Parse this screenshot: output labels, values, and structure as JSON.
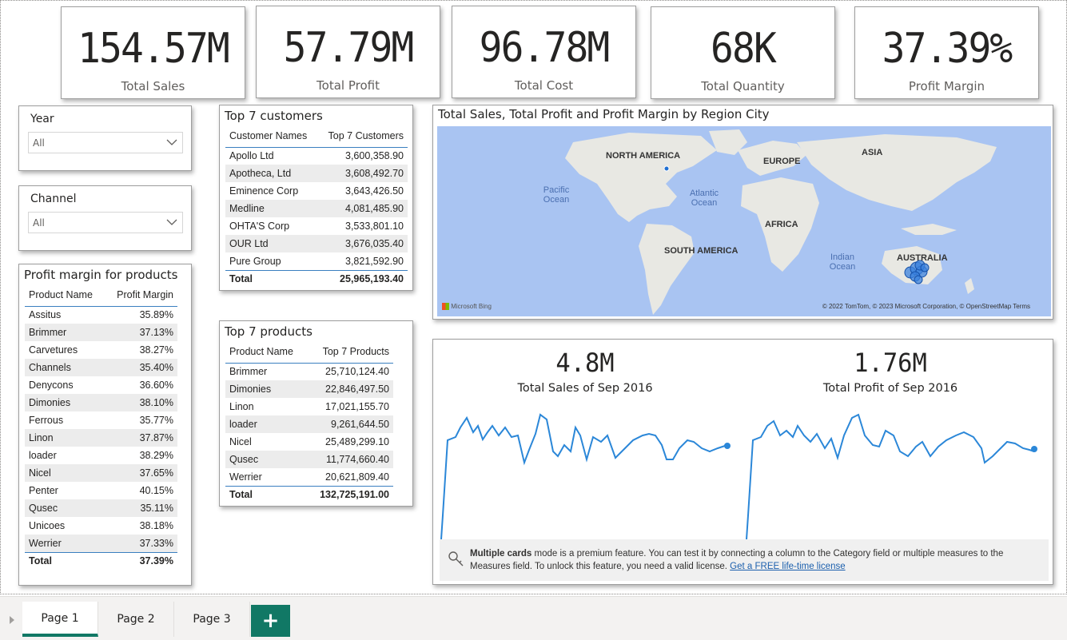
{
  "kpis": [
    {
      "value": "154.57M",
      "label": "Total Sales"
    },
    {
      "value": "57.79M",
      "label": "Total Profit"
    },
    {
      "value": "96.78M",
      "label": "Total Cost"
    },
    {
      "value": "68K",
      "label": "Total Quantity"
    },
    {
      "value": "37.39%",
      "label": "Profit Margin"
    }
  ],
  "slicers": {
    "year": {
      "title": "Year",
      "value": "All"
    },
    "channel": {
      "title": "Channel",
      "value": "All"
    }
  },
  "profit_margin_table": {
    "title": "Profit margin for products",
    "columns": [
      "Product Name",
      "Profit Margin"
    ],
    "rows": [
      [
        "Assitus",
        "35.89%"
      ],
      [
        "Brimmer",
        "37.13%"
      ],
      [
        "Carvetures",
        "38.27%"
      ],
      [
        "Channels",
        "35.40%"
      ],
      [
        "Denycons",
        "36.60%"
      ],
      [
        "Dimonies",
        "38.10%"
      ],
      [
        "Ferrous",
        "35.77%"
      ],
      [
        "Linon",
        "37.87%"
      ],
      [
        "loader",
        "38.29%"
      ],
      [
        "Nicel",
        "37.65%"
      ],
      [
        "Penter",
        "40.15%"
      ],
      [
        "Qusec",
        "35.11%"
      ],
      [
        "Unicoes",
        "38.18%"
      ],
      [
        "Werrier",
        "37.33%"
      ]
    ],
    "total": [
      "Total",
      "37.39%"
    ]
  },
  "top_customers_table": {
    "title": "Top 7 customers",
    "columns": [
      "Customer Names",
      "Top 7 Customers"
    ],
    "rows": [
      [
        "Apollo Ltd",
        "3,600,358.90"
      ],
      [
        "Apotheca, Ltd",
        "3,608,492.70"
      ],
      [
        "Eminence Corp",
        "3,643,426.50"
      ],
      [
        "Medline",
        "4,081,485.90"
      ],
      [
        "OHTA'S Corp",
        "3,533,801.10"
      ],
      [
        "OUR Ltd",
        "3,676,035.40"
      ],
      [
        "Pure Group",
        "3,821,592.90"
      ]
    ],
    "total": [
      "Total",
      "25,965,193.40"
    ]
  },
  "top_products_table": {
    "title": "Top 7 products",
    "columns": [
      "Product Name",
      "Top 7 Products"
    ],
    "rows": [
      [
        "Brimmer",
        "25,710,124.40"
      ],
      [
        "Dimonies",
        "22,846,497.50"
      ],
      [
        "Linon",
        "17,021,155.70"
      ],
      [
        "loader",
        "9,261,644.50"
      ],
      [
        "Nicel",
        "25,489,299.10"
      ],
      [
        "Qusec",
        "11,774,660.40"
      ],
      [
        "Werrier",
        "20,621,809.40"
      ]
    ],
    "total": [
      "Total",
      "132,725,191.00"
    ]
  },
  "map": {
    "title": "Total Sales, Total Profit and Profit Margin by Region City",
    "continents": [
      "NORTH AMERICA",
      "EUROPE",
      "ASIA",
      "AFRICA",
      "SOUTH AMERICA",
      "AUSTRALIA"
    ],
    "oceans": [
      "Pacific Ocean",
      "Atlantic Ocean",
      "Indian Ocean"
    ],
    "credit": "© 2022 TomTom, © 2023 Microsoft Corporation, © OpenStreetMap  Terms",
    "provider": "Microsoft Bing",
    "bubble_color": "#1f6fd1"
  },
  "multi_card": {
    "cards": [
      {
        "value": "4.8M",
        "label": "Total Sales of Sep 2016"
      },
      {
        "value": "1.76M",
        "label": "Total Profit of Sep 2016"
      }
    ],
    "line_color": "#2b87d8",
    "premium_bold": "Multiple cards",
    "premium_text": " mode is a premium feature. You can test it by connecting a column to the Category field or multiple measures to the Measures field. To unlock this feature, you need a valid license. ",
    "premium_link": "Get a FREE life-time license"
  },
  "tabs": {
    "pages": [
      "Page 1",
      "Page 2",
      "Page 3"
    ],
    "active": "Page 1",
    "add_label": "+",
    "accent": "#117865"
  }
}
